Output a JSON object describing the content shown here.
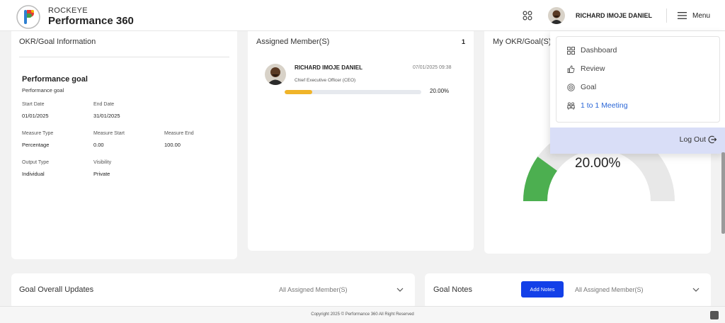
{
  "brand": {
    "top": "ROCKEYE",
    "main": "Performance 360"
  },
  "header": {
    "user_name": "RICHARD IMOJE DANIEL",
    "menu_label": "Menu"
  },
  "okr_card": {
    "title": "OKR/Goal Information",
    "goal_name": "Performance goal",
    "goal_desc": "Performance goal",
    "fields": {
      "start_date_label": "Start Date",
      "start_date": "01/01/2025",
      "end_date_label": "End Date",
      "end_date": "31/01/2025",
      "measure_type_label": "Measure Type",
      "measure_type": "Percentage",
      "measure_start_label": "Measure Start",
      "measure_start": "0.00",
      "measure_end_label": "Measure End",
      "measure_end": "100.00",
      "output_type_label": "Output Type",
      "output_type": "Individual",
      "visibility_label": "Visibility",
      "visibility": "Private"
    }
  },
  "assigned": {
    "title": "Assigned Member(S)",
    "count": "1",
    "member": {
      "name": "RICHARD IMOJE DANIEL",
      "datetime": "07/01/2025 09:38",
      "role": "Chief Executive Officer (CEO)",
      "progress_label": "20.00%",
      "progress": 0.2
    }
  },
  "my_okr": {
    "title": "My OKR/Goal(S)",
    "value_label": "20.00%"
  },
  "dropdown": {
    "items": [
      {
        "label": "Dashboard",
        "icon": "dashboard-icon"
      },
      {
        "label": "Review",
        "icon": "thumbs-up-icon"
      },
      {
        "label": "Goal",
        "icon": "goal-icon"
      },
      {
        "label": "1 to 1 Meeting",
        "icon": "meeting-icon"
      }
    ],
    "logout": "Log Out"
  },
  "updates": {
    "title": "Goal Overall Updates",
    "filter": "All Assigned Member(S)"
  },
  "notes": {
    "title": "Goal Notes",
    "add_button": "Add Notes",
    "filter": "All Assigned Member(S)"
  },
  "footer": {
    "copyright": "Copyright 2025 © Performance 360 All Right Reserved"
  },
  "colors": {
    "accent": "#1340e8",
    "progress": "#f0b429",
    "gauge_green": "#4caf50",
    "menu_active": "#2a66d6",
    "logout_bg": "#d9def7"
  }
}
